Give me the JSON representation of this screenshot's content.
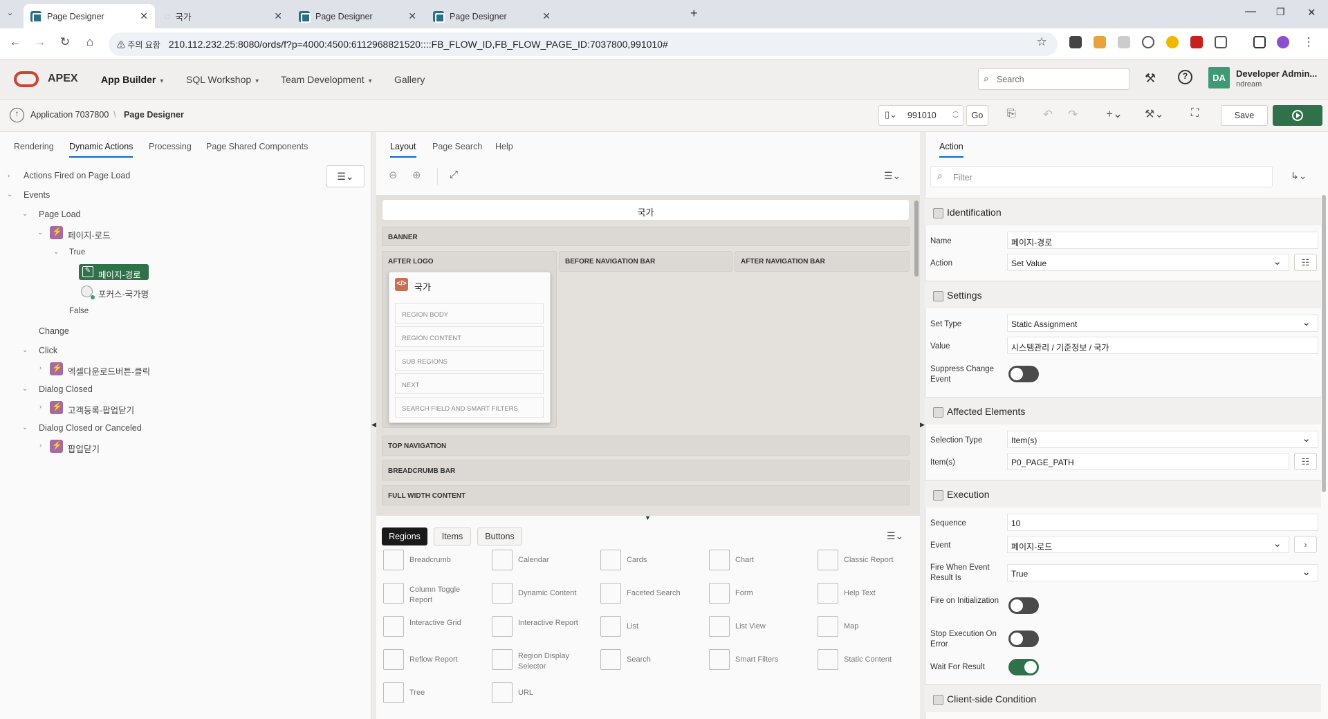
{
  "browser": {
    "tabs": [
      {
        "title": "Page Designer"
      },
      {
        "title": "국가"
      },
      {
        "title": "Page Designer"
      },
      {
        "title": "Page Designer"
      }
    ],
    "security_label": "주의 요함",
    "url": "210.112.232.25:8080/ords/f?p=4000:4500:6112968821520::::FB_FLOW_ID,FB_FLOW_PAGE_ID:7037800,991010#"
  },
  "header": {
    "logo_text": "APEX",
    "menu": [
      "App Builder",
      "SQL Workshop",
      "Team Development",
      "Gallery"
    ],
    "search_placeholder": "Search",
    "user_initials": "DA",
    "user_name": "Developer Admin...",
    "user_workspace": "ndream"
  },
  "toolbar": {
    "app_label": "Application 7037800",
    "page_label": "Page Designer",
    "page_number": "991010",
    "go_label": "Go",
    "save_label": "Save"
  },
  "left": {
    "tabs": [
      "Rendering",
      "Dynamic Actions",
      "Processing",
      "Page Shared Components"
    ],
    "tree": {
      "on_load": "Actions Fired on Page Load",
      "events": "Events",
      "page_load": "Page Load",
      "da_page_load": "페이지-로드",
      "true_label": "True",
      "action_selected": "페이지-경로",
      "action_focus": "포커스-국가명",
      "false_label": "False",
      "change": "Change",
      "click": "Click",
      "da_excel": "엑셀다운로드버튼-클릭",
      "dialog_closed": "Dialog Closed",
      "da_customer": "고객등록-팝업닫기",
      "dialog_closed_canceled": "Dialog Closed or Canceled",
      "da_popup": "팝업닫기"
    }
  },
  "middle": {
    "tabs": [
      "Layout",
      "Page Search",
      "Help"
    ],
    "page_title": "국가",
    "positions": {
      "banner": "BANNER",
      "after_logo": "AFTER LOGO",
      "before_nav": "BEFORE NAVIGATION BAR",
      "after_nav": "AFTER NAVIGATION BAR",
      "top_nav": "TOP NAVIGATION",
      "breadcrumb": "BREADCRUMB BAR",
      "full_width": "FULL WIDTH CONTENT"
    },
    "region": {
      "title": "국가",
      "subs": [
        "REGION BODY",
        "REGION CONTENT",
        "SUB REGIONS",
        "NEXT",
        "SEARCH FIELD AND SMART FILTERS"
      ]
    },
    "gallery_tabs": [
      "Regions",
      "Items",
      "Buttons"
    ],
    "gallery_items": [
      [
        "Breadcrumb",
        "Calendar",
        "Cards",
        "Chart",
        "Classic Report"
      ],
      [
        "Column Toggle Report",
        "Dynamic Content",
        "Faceted Search",
        "Form",
        "Help Text"
      ],
      [
        "Interactive Grid",
        "Interactive Report",
        "List",
        "List View",
        "Map"
      ],
      [
        "Reflow Report",
        "Region Display Selector",
        "Search",
        "Smart Filters",
        "Static Content"
      ],
      [
        "Tree",
        "URL"
      ]
    ]
  },
  "right": {
    "tab": "Action",
    "filter_placeholder": "Filter",
    "sections": {
      "identification": "Identification",
      "settings": "Settings",
      "affected": "Affected Elements",
      "execution": "Execution",
      "client": "Client-side Condition"
    },
    "labels": {
      "name": "Name",
      "action": "Action",
      "set_type": "Set Type",
      "value": "Value",
      "suppress": "Suppress Change Event",
      "selection_type": "Selection Type",
      "items": "Item(s)",
      "sequence": "Sequence",
      "event": "Event",
      "fire_when": "Fire When Event Result Is",
      "fire_init": "Fire on Initialization",
      "stop_exec": "Stop Execution On Error",
      "wait": "Wait For Result"
    },
    "values": {
      "name": "페이지-경로",
      "action": "Set Value",
      "set_type": "Static Assignment",
      "value": "시스템관리 / 기준정보 / 국가",
      "selection_type": "Item(s)",
      "items": "P0_PAGE_PATH",
      "sequence": "10",
      "event": "페이지-로드",
      "fire_when": "True"
    },
    "toggles": {
      "suppress": false,
      "fire_init": false,
      "stop_exec": false,
      "wait": true
    }
  }
}
